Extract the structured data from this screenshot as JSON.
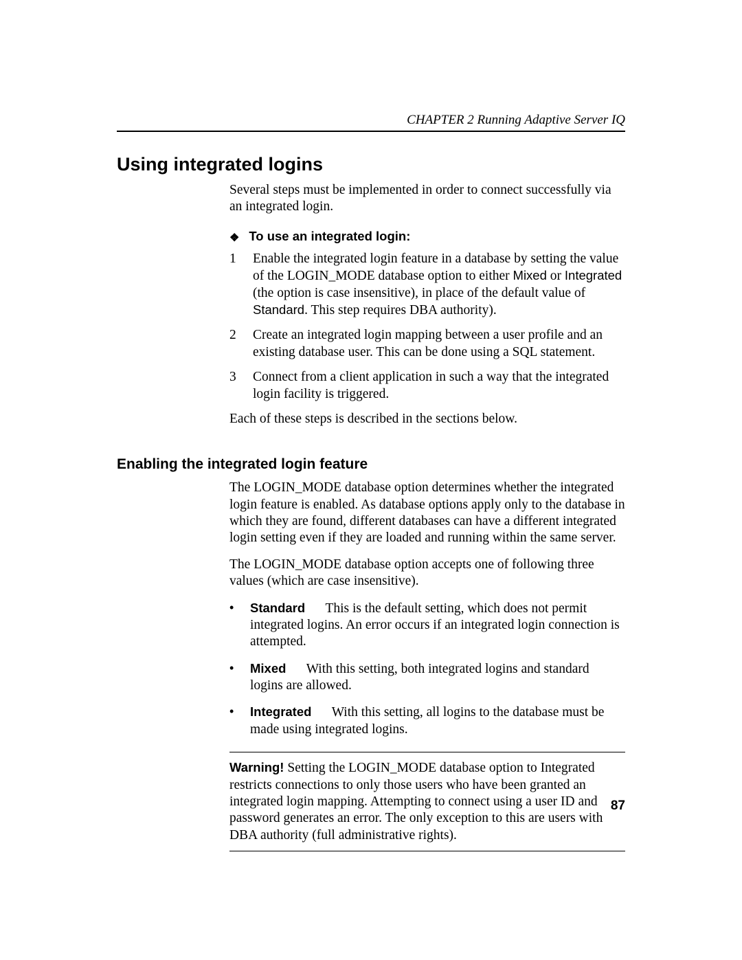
{
  "header": {
    "running_head": "CHAPTER 2    Running Adaptive Server IQ"
  },
  "section": {
    "title": "Using integrated logins",
    "intro": "Several steps must be implemented in order to connect successfully via an integrated login.",
    "proc_heading": "To use an integrated login:",
    "steps": {
      "s1": {
        "num": "1",
        "text_1": "Enable the integrated login feature in a database by setting the value of the LOGIN_MODE database option to either ",
        "opt_mixed": "Mixed",
        "text_2": " or ",
        "opt_integrated": "Integrated",
        "text_3": " (the option is case insensitive), in place of the default value of ",
        "opt_standard": "Standard",
        "text_4": ". This step requires DBA authority)."
      },
      "s2": {
        "num": "2",
        "text": "Create an integrated login mapping between a user profile and an existing database user. This can be done using a SQL statement."
      },
      "s3": {
        "num": "3",
        "text": "Connect from a client application in such a way that the integrated login facility is triggered."
      }
    },
    "outro": "Each of these steps is described in the sections below."
  },
  "subsection": {
    "title": "Enabling the integrated login feature",
    "p1": "The LOGIN_MODE database option determines whether the integrated login feature is enabled. As database options apply only to the database in which they are found, different databases can have a different integrated login setting even if they are loaded and running within the same server.",
    "p2": "The LOGIN_MODE database option accepts one of following three values (which are case insensitive).",
    "bullets": {
      "standard": {
        "term": "Standard",
        "desc": "This is the default setting, which does not permit integrated logins. An error occurs if an integrated login connection is attempted."
      },
      "mixed": {
        "term": "Mixed",
        "desc": "With this setting, both integrated logins and standard logins are allowed."
      },
      "integrated": {
        "term": "Integrated",
        "desc": "With this setting, all logins to the database must be made using integrated logins."
      }
    },
    "warning": {
      "label": "Warning!",
      "text": " Setting the LOGIN_MODE database option to Integrated restricts connections to only those users who have been granted an integrated login mapping. Attempting to connect using a user ID and password generates an error. The only exception to this are users with DBA authority (full administrative rights)."
    }
  },
  "page_number": "87"
}
